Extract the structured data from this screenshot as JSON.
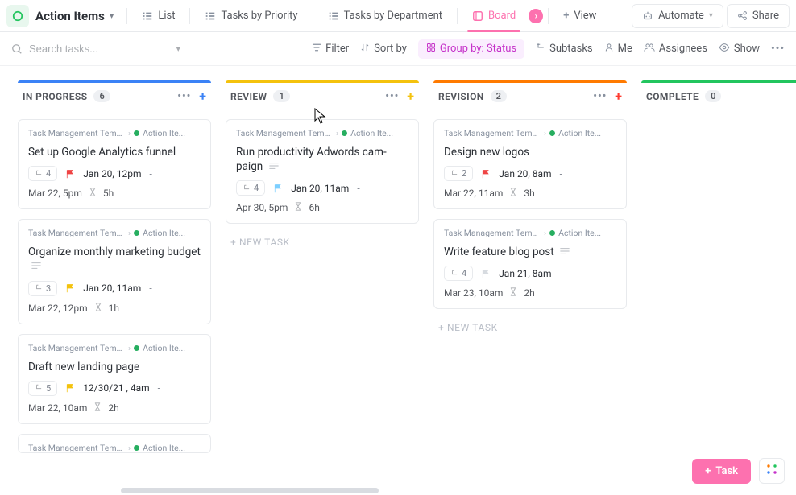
{
  "header": {
    "space_title": "Action Items",
    "views": {
      "list": "List",
      "priority": "Tasks by Priority",
      "department": "Tasks by Department",
      "board": "Board",
      "add_view": "View"
    },
    "automate": "Automate",
    "share": "Share"
  },
  "toolbar": {
    "search_placeholder": "Search tasks...",
    "filter": "Filter",
    "sort": "Sort by",
    "group": "Group by: Status",
    "subtasks": "Subtasks",
    "me": "Me",
    "assignees": "Assignees",
    "show": "Show"
  },
  "crumb": {
    "a": "Task Management Templat...",
    "b": "Action Ite..."
  },
  "new_task_label": "+ NEW TASK",
  "columns": [
    {
      "id": "in_progress",
      "title": "IN PROGRESS",
      "count": "6",
      "accent": "#3b82f6",
      "plus": "#3b82f6",
      "cards": [
        {
          "title": "Set up Google Analytics funnel",
          "has_desc": false,
          "subtasks": "4",
          "flag": "#ef4444",
          "due": "Jan 20, 12pm",
          "time_date": "Mar 22, 5pm",
          "time_est": "5h"
        },
        {
          "title": "Organize monthly marketing budget",
          "has_desc": true,
          "subtasks": "3",
          "flag": "#f4c20d",
          "due": "Jan 20, 11am",
          "time_date": "Mar 22, 12pm",
          "time_est": "1h"
        },
        {
          "title": "Draft new landing page",
          "has_desc": false,
          "subtasks": "5",
          "flag": "#f4c20d",
          "due": "12/30/21 , 4am",
          "time_date": "Mar 22, 10am",
          "time_est": "2h"
        }
      ],
      "show_new_task": false,
      "partial_card": true
    },
    {
      "id": "review",
      "title": "REVIEW",
      "count": "1",
      "accent": "#f4c20d",
      "plus": "#f4c20d",
      "cards": [
        {
          "title": "Run productivity Adwords cam­paign",
          "has_desc": true,
          "subtasks": "4",
          "flag": "#7dcfff",
          "due": "Jan 20, 11am",
          "time_date": "Apr 30, 5pm",
          "time_est": "6h"
        }
      ],
      "show_new_task": true
    },
    {
      "id": "revision",
      "title": "REVISION",
      "count": "2",
      "accent": "#ff7a00",
      "plus": "#ff3b30",
      "cards": [
        {
          "title": "Design new logos",
          "has_desc": false,
          "subtasks": "2",
          "flag": "#ef4444",
          "due": "Jan 20, 8am",
          "time_date": "Mar 22, 11am",
          "time_est": "3h"
        },
        {
          "title": "Write feature blog post",
          "has_desc": true,
          "subtasks": "4",
          "flag": "#d7dbe0",
          "due": "Jan 21, 8am",
          "time_date": "Mar 23, 10am",
          "time_est": "2h"
        }
      ],
      "show_new_task": true
    },
    {
      "id": "complete",
      "title": "COMPLETE",
      "count": "0",
      "accent": "#22c55e",
      "plus": "#22c55e",
      "cards": [],
      "show_new_task": false,
      "hide_header_actions": true
    }
  ],
  "fab": {
    "task": "Task"
  }
}
